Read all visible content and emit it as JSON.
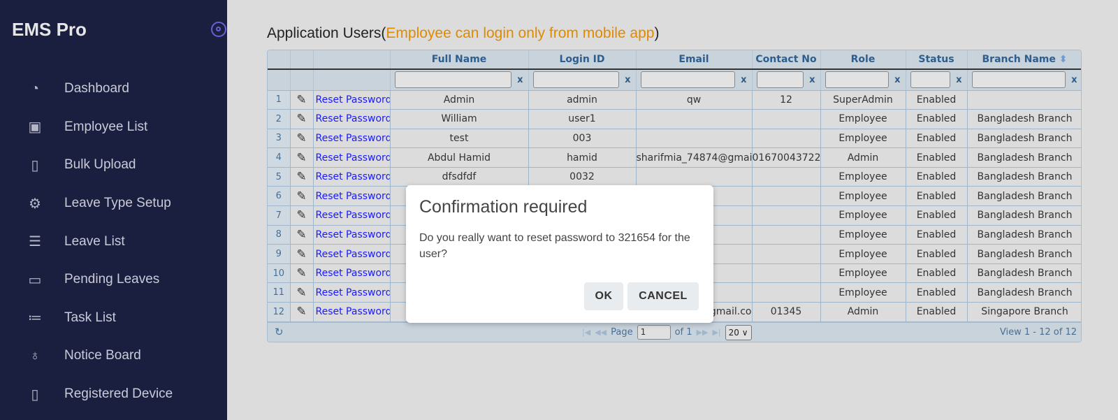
{
  "sidebar": {
    "brand": "EMS Pro",
    "items": [
      {
        "label": "Dashboard",
        "icon": "dashboard-icon",
        "glyph": "◔"
      },
      {
        "label": "Employee List",
        "icon": "contact-book-icon",
        "glyph": "▣"
      },
      {
        "label": "Bulk Upload",
        "icon": "book-icon",
        "glyph": "▯"
      },
      {
        "label": "Leave Type Setup",
        "icon": "gear-icon",
        "glyph": "⚙"
      },
      {
        "label": "Leave List",
        "icon": "list-icon",
        "glyph": "☰"
      },
      {
        "label": "Pending Leaves",
        "icon": "archive-icon",
        "glyph": "▭"
      },
      {
        "label": "Task List",
        "icon": "task-list-icon",
        "glyph": "≔"
      },
      {
        "label": "Notice Board",
        "icon": "award-icon",
        "glyph": "♁"
      },
      {
        "label": "Registered Device",
        "icon": "mobile-icon",
        "glyph": "▯"
      }
    ]
  },
  "page": {
    "title": "Application Users(",
    "note": "Employee can login only from mobile app",
    "title_end": ")"
  },
  "grid": {
    "columns": [
      "",
      "",
      "",
      "Full Name",
      "Login ID",
      "Email",
      "Contact No",
      "Role",
      "Status",
      "Branch Name"
    ],
    "sort_icon": "sort-icon",
    "filter_clear": "x",
    "reset_label": "Reset Password",
    "rows": [
      [
        "1",
        "Admin",
        "admin",
        "qw",
        "12",
        "SuperAdmin",
        "Enabled",
        ""
      ],
      [
        "2",
        "William",
        "user1",
        "",
        "",
        "Employee",
        "Enabled",
        "Bangladesh Branch"
      ],
      [
        "3",
        "test",
        "003",
        "",
        "",
        "Employee",
        "Enabled",
        "Bangladesh Branch"
      ],
      [
        "4",
        "Abdul Hamid",
        "hamid",
        "sharifmia_74874@gmai",
        "01670043722",
        "Admin",
        "Enabled",
        "Bangladesh Branch"
      ],
      [
        "5",
        "dfsdfdf",
        "0032",
        "",
        "",
        "Employee",
        "Enabled",
        "Bangladesh Branch"
      ],
      [
        "6",
        "",
        "",
        "",
        "",
        "Employee",
        "Enabled",
        "Bangladesh Branch"
      ],
      [
        "7",
        "",
        "",
        "",
        "",
        "Employee",
        "Enabled",
        "Bangladesh Branch"
      ],
      [
        "8",
        "",
        "",
        "",
        "",
        "Employee",
        "Enabled",
        "Bangladesh Branch"
      ],
      [
        "9",
        "",
        "",
        "",
        "",
        "Employee",
        "Enabled",
        "Bangladesh Branch"
      ],
      [
        "10",
        "",
        "",
        "",
        "",
        "Employee",
        "Enabled",
        "Bangladesh Branch"
      ],
      [
        "11",
        "",
        "",
        "",
        "",
        "Employee",
        "Enabled",
        "Bangladesh Branch"
      ],
      [
        "12",
        "",
        "",
        "gmail.co",
        "01345",
        "Admin",
        "Enabled",
        "Singapore Branch"
      ]
    ],
    "footer": {
      "page_label": "Page",
      "page": "1",
      "of": "of 1",
      "page_size": "20",
      "view": "View 1 - 12 of 12"
    }
  },
  "dialog": {
    "title": "Confirmation required",
    "message": "Do you really want to reset password to 321654 for the user?",
    "ok": "OK",
    "cancel": "CANCEL"
  },
  "colors": {
    "sidebar": "#1b1f3f",
    "accent": "#e08a00",
    "link": "#1a1aff",
    "header_text": "#2d5e8e"
  }
}
